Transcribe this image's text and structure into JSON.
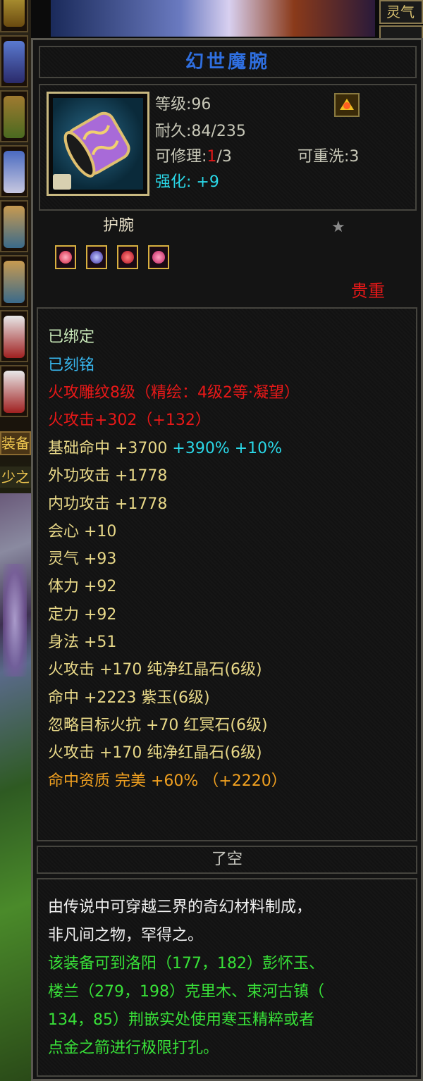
{
  "left_tabs": {
    "equip": "装备",
    "sub": "少之"
  },
  "right_tab": {
    "label": "灵气"
  },
  "item": {
    "name": "幻世魔腕",
    "level": "等级:96",
    "durability": "耐久:84/235",
    "repair_prefix": "可修理:",
    "repair_current": "1",
    "repair_suffix": "/3",
    "rewash": "可重洗:3",
    "enhance_label": "强化:",
    "enhance_value": "+9",
    "type": "护腕",
    "rarity": "贵重",
    "rarity_color": "#e81818"
  },
  "attributes": [
    {
      "text": "已绑定",
      "color": "#c8e8b8"
    },
    {
      "text": "已刻铭",
      "color": "#38b8f0"
    },
    {
      "text": "火攻雕纹8级（精绘：4级2等·凝望）",
      "color": "#e81818"
    },
    {
      "text": "火攻击+302（+132）",
      "color": "#e81818"
    }
  ],
  "hit_line": {
    "label": "基础命中 +3700 ",
    "extra": "+390% +10%"
  },
  "stats": [
    "外功攻击 +1778",
    "内功攻击 +1778",
    "会心 +10",
    "灵气 +93",
    "体力 +92",
    "定力 +92",
    "身法 +51",
    "火攻击 +170 纯净红晶石(6级)",
    "命中 +2223 紫玉(6级)",
    "忽略目标火抗 +70 红冥石(6级)",
    "火攻击 +170 纯净红晶石(6级)"
  ],
  "aptitude": "命中资质   完美 +60% （+2220）",
  "crafter": "了空",
  "description": {
    "line1": "由传说中可穿越三界的奇幻材料制成，",
    "line2": "非凡间之物，罕得之。",
    "line3": "该装备可到洛阳（177，182）彭怀玉、",
    "line4": "楼兰（279，198）克里木、束河古镇（",
    "line5": "134，85）荆嵌实处使用寒玉精粹或者",
    "line6": "点金之箭进行极限打孔。"
  },
  "icons": [
    "bracer-icon",
    "lock-icon",
    "star-icon",
    "gem-red-icon",
    "gem-purple-icon",
    "gem-crimson-icon",
    "gem-ruby-icon",
    "sparkle-icon"
  ]
}
